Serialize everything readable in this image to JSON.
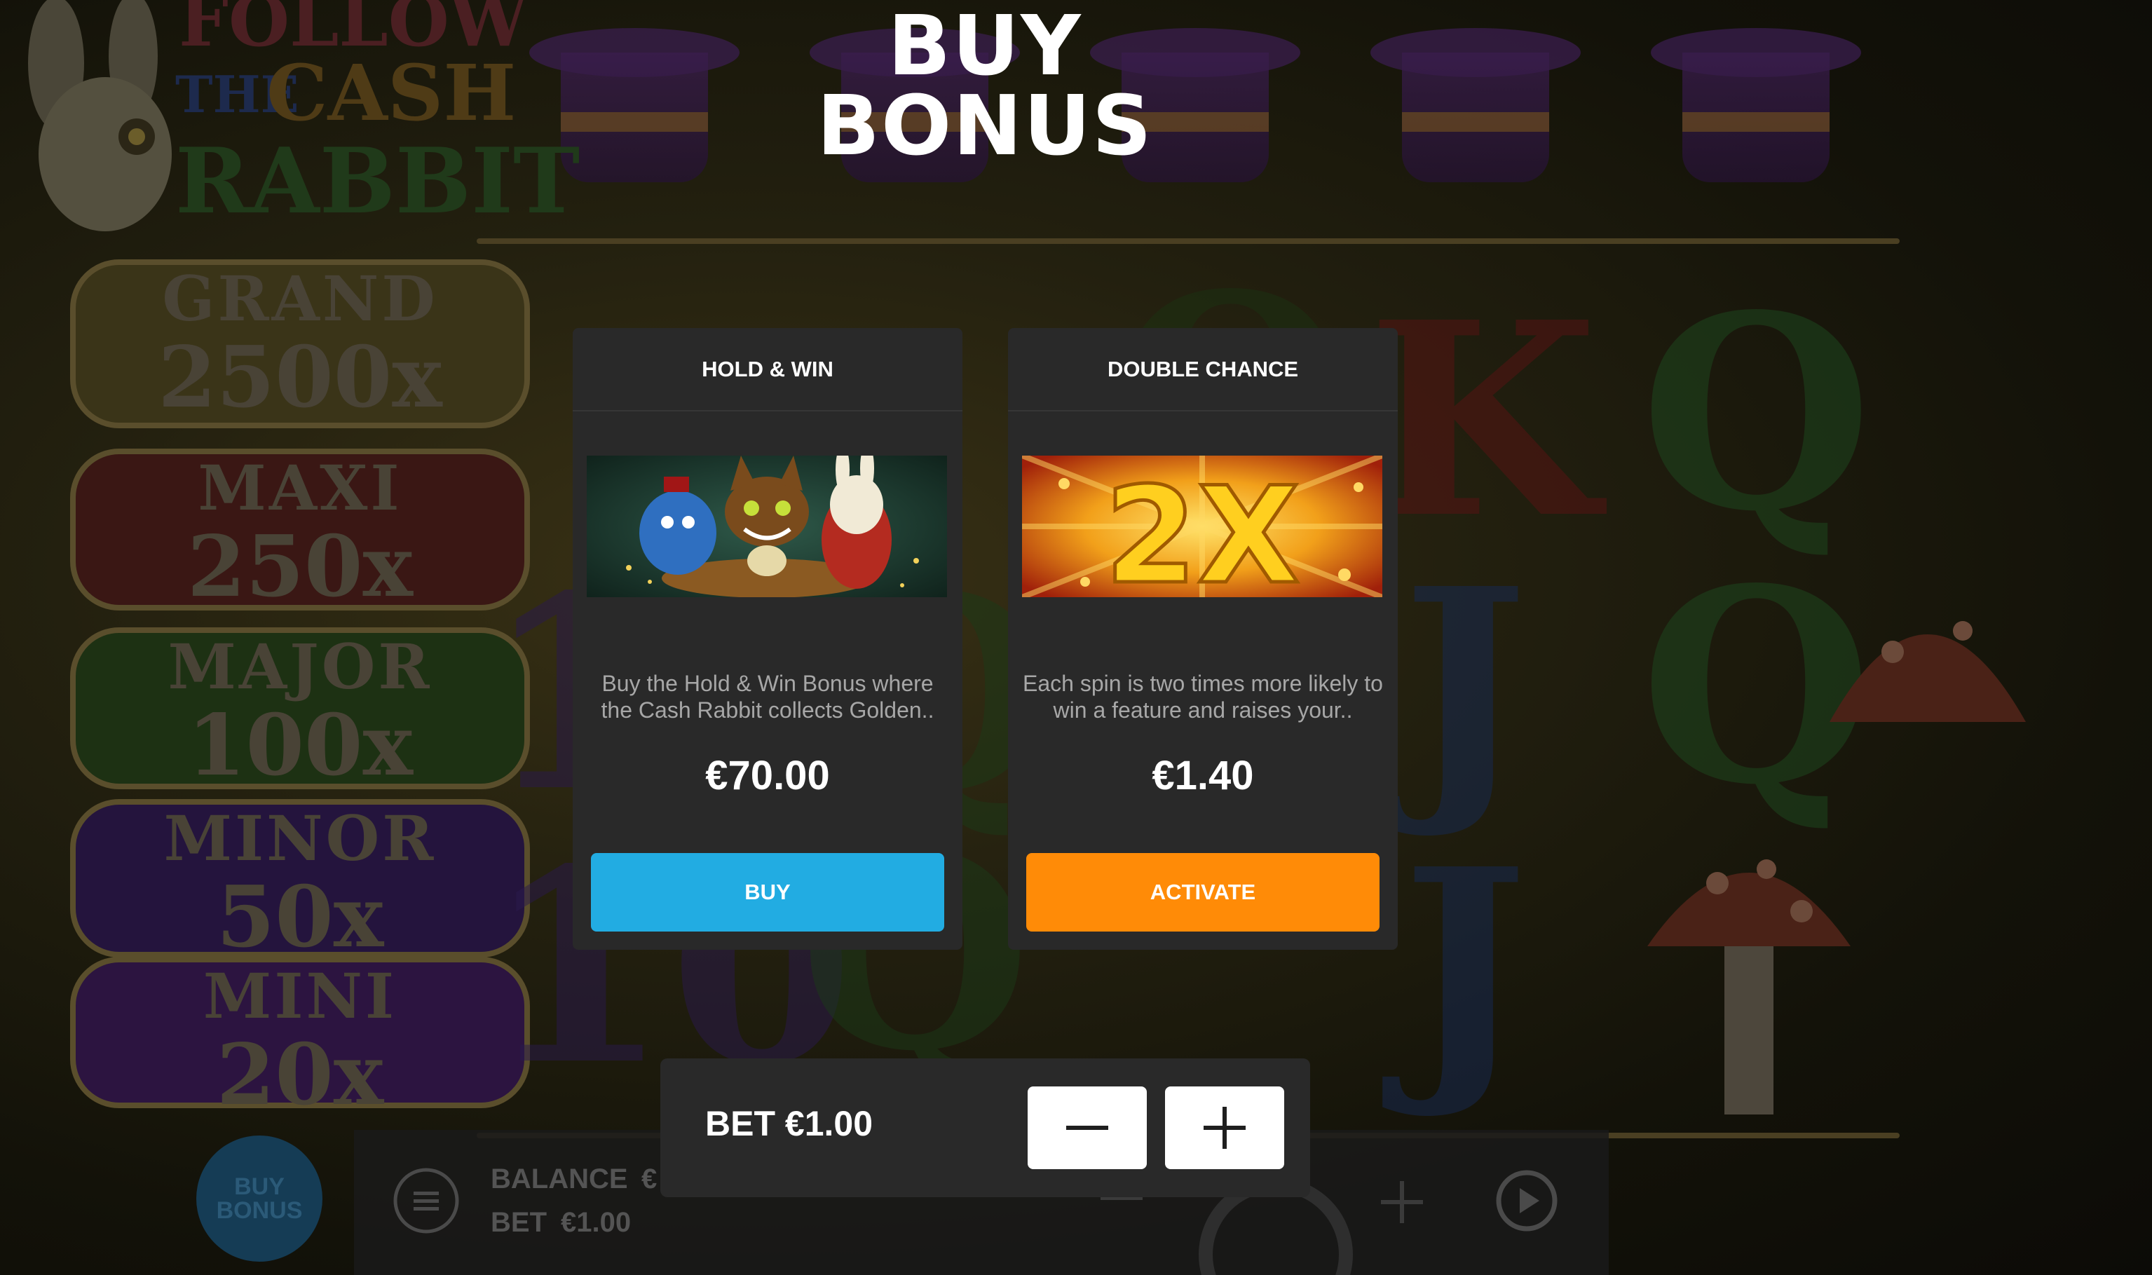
{
  "game": {
    "logo_lines": [
      "FOLLOW",
      "THE",
      "CASH",
      "RABBIT"
    ],
    "jackpots": [
      {
        "name": "GRAND",
        "multiplier": "2500x"
      },
      {
        "name": "MAXI",
        "multiplier": "250x"
      },
      {
        "name": "MAJOR",
        "multiplier": "100x"
      },
      {
        "name": "MINOR",
        "multiplier": "50x"
      },
      {
        "name": "MINI",
        "multiplier": "20x"
      }
    ],
    "reel_symbols": [
      "K",
      "Q",
      "Q",
      "Q",
      "J",
      "J",
      "10",
      "10",
      "Q",
      "Q"
    ],
    "buy_bonus_badge": "BUY BONUS",
    "bottom_bar": {
      "balance_label": "BALANCE",
      "balance_value": "€",
      "bet_label": "BET",
      "bet_value": "€1.00"
    }
  },
  "modal": {
    "title_line1": "BUY",
    "title_line2": "BONUS",
    "cards": [
      {
        "title": "HOLD & WIN",
        "image": "mad-tea-party-illustration",
        "description": "Buy the Hold & Win Bonus where the Cash Rabbit collects Golden..",
        "price": "€70.00",
        "button_label": "BUY",
        "button_color": "#22ace2"
      },
      {
        "title": "DOUBLE CHANCE",
        "image": "2x-gold-burst-illustration",
        "image_text": "2X",
        "description": "Each spin is two times more likely to win a feature and raises your..",
        "price": "€1.40",
        "button_label": "ACTIVATE",
        "button_color": "#ff8b07"
      }
    ],
    "bet": {
      "label": "BET €1.00",
      "decrease_icon": "minus-icon",
      "increase_icon": "plus-icon"
    }
  },
  "colors": {
    "panel": "#292929",
    "buy_button": "#22ace2",
    "activate_button": "#ff8b07",
    "title_text": "#ffffff",
    "description_text": "#a7a7a7"
  }
}
